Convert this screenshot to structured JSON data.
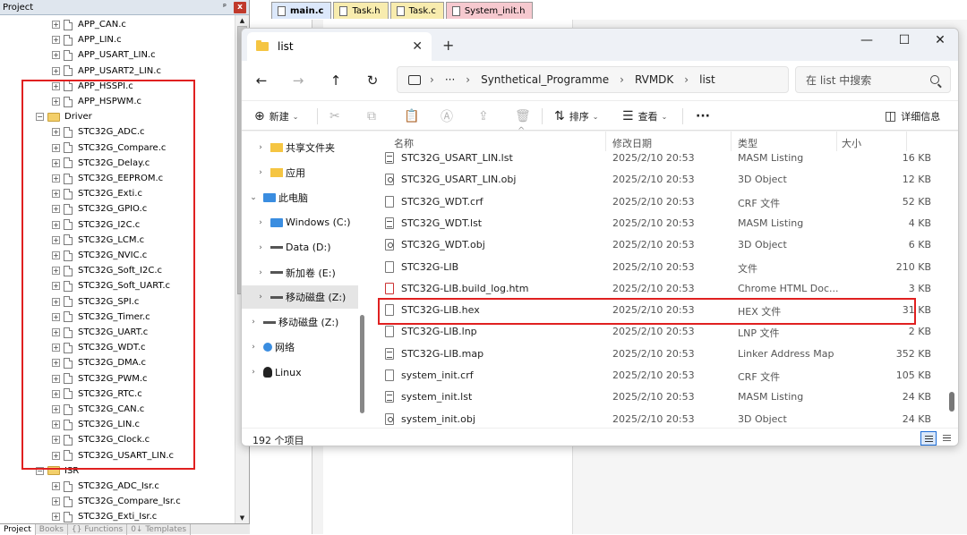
{
  "ide": {
    "project_title": "Project",
    "pin": "ᵖ",
    "close": "x",
    "tree": [
      {
        "label": "APP_CAN.c",
        "level": 2,
        "type": "file"
      },
      {
        "label": "APP_LIN.c",
        "level": 2,
        "type": "file"
      },
      {
        "label": "APP_USART_LIN.c",
        "level": 2,
        "type": "file"
      },
      {
        "label": "APP_USART2_LIN.c",
        "level": 2,
        "type": "file"
      },
      {
        "label": "APP_HSSPI.c",
        "level": 2,
        "type": "file"
      },
      {
        "label": "APP_HSPWM.c",
        "level": 2,
        "type": "file"
      },
      {
        "label": "Driver",
        "level": 1,
        "type": "folder"
      },
      {
        "label": "STC32G_ADC.c",
        "level": 2,
        "type": "file"
      },
      {
        "label": "STC32G_Compare.c",
        "level": 2,
        "type": "file"
      },
      {
        "label": "STC32G_Delay.c",
        "level": 2,
        "type": "file"
      },
      {
        "label": "STC32G_EEPROM.c",
        "level": 2,
        "type": "file"
      },
      {
        "label": "STC32G_Exti.c",
        "level": 2,
        "type": "file"
      },
      {
        "label": "STC32G_GPIO.c",
        "level": 2,
        "type": "file"
      },
      {
        "label": "STC32G_I2C.c",
        "level": 2,
        "type": "file"
      },
      {
        "label": "STC32G_LCM.c",
        "level": 2,
        "type": "file"
      },
      {
        "label": "STC32G_NVIC.c",
        "level": 2,
        "type": "file"
      },
      {
        "label": "STC32G_Soft_I2C.c",
        "level": 2,
        "type": "file"
      },
      {
        "label": "STC32G_Soft_UART.c",
        "level": 2,
        "type": "file"
      },
      {
        "label": "STC32G_SPI.c",
        "level": 2,
        "type": "file"
      },
      {
        "label": "STC32G_Timer.c",
        "level": 2,
        "type": "file"
      },
      {
        "label": "STC32G_UART.c",
        "level": 2,
        "type": "file"
      },
      {
        "label": "STC32G_WDT.c",
        "level": 2,
        "type": "file"
      },
      {
        "label": "STC32G_DMA.c",
        "level": 2,
        "type": "file"
      },
      {
        "label": "STC32G_PWM.c",
        "level": 2,
        "type": "file"
      },
      {
        "label": "STC32G_RTC.c",
        "level": 2,
        "type": "file"
      },
      {
        "label": "STC32G_CAN.c",
        "level": 2,
        "type": "file"
      },
      {
        "label": "STC32G_LIN.c",
        "level": 2,
        "type": "file"
      },
      {
        "label": "STC32G_Clock.c",
        "level": 2,
        "type": "file"
      },
      {
        "label": "STC32G_USART_LIN.c",
        "level": 2,
        "type": "file"
      },
      {
        "label": "ISR",
        "level": 1,
        "type": "folder"
      },
      {
        "label": "STC32G_ADC_Isr.c",
        "level": 2,
        "type": "file"
      },
      {
        "label": "STC32G_Compare_Isr.c",
        "level": 2,
        "type": "file"
      },
      {
        "label": "STC32G_Exti_Isr.c",
        "level": 2,
        "type": "file"
      }
    ],
    "bottom_tabs": [
      "Project",
      "Books",
      "{} Functions",
      "0↓ Templates"
    ],
    "editor_tabs": [
      {
        "label": "main.c",
        "color": "#dce8fb"
      },
      {
        "label": "Task.h",
        "color": "#f8ecae"
      },
      {
        "label": "Task.c",
        "color": "#f8ecae"
      },
      {
        "label": "System_init.h",
        "color": "#f6c9cf"
      }
    ]
  },
  "explorer": {
    "tab_title": "list",
    "new_tab": "+",
    "tab_close": "✕",
    "caption": {
      "min": "—",
      "max": "☐",
      "close": "✕"
    },
    "nav": {
      "back": "←",
      "forward": "→",
      "up": "↑",
      "refresh": "↻"
    },
    "breadcrumb": {
      "more": "···",
      "chevron": "›",
      "items": [
        "Synthetical_Programme",
        "RVMDK",
        "list"
      ]
    },
    "search_placeholder": "在 list 中搜索",
    "commands": {
      "new": "新建",
      "new_icon": "⊕",
      "cut_icon": "✂",
      "copy_icon": "⧉",
      "paste_icon": "📋",
      "rename_icon": "Ⓐ",
      "share_icon": "⇪",
      "delete_icon": "🗑",
      "sort": "排序",
      "sort_icon": "⇅",
      "view": "查看",
      "view_icon": "☰",
      "more": "···",
      "details": "详细信息",
      "details_icon": "◫",
      "dropdown": "⌄"
    },
    "nav_pane": [
      {
        "label": "共享文件夹",
        "icon": "star",
        "chevron": "›",
        "level": 1
      },
      {
        "label": "应用",
        "icon": "fold",
        "chevron": "›",
        "level": 1
      },
      {
        "label": "此电脑",
        "icon": "pc",
        "chevron": "⌄",
        "level": 0
      },
      {
        "label": "Windows (C:)",
        "icon": "pc",
        "chevron": "›",
        "level": 1
      },
      {
        "label": "Data (D:)",
        "icon": "drv",
        "chevron": "›",
        "level": 1
      },
      {
        "label": "新加卷 (E:)",
        "icon": "drv",
        "chevron": "›",
        "level": 1
      },
      {
        "label": "移动磁盘 (Z:)",
        "icon": "drv",
        "chevron": "›",
        "level": 1,
        "selected": true
      },
      {
        "label": "移动磁盘 (Z:)",
        "icon": "drv",
        "chevron": "›",
        "level": 0
      },
      {
        "label": "网络",
        "icon": "net",
        "chevron": "›",
        "level": 0
      },
      {
        "label": "Linux",
        "icon": "tux",
        "chevron": "›",
        "level": 0
      }
    ],
    "columns": {
      "name": "名称",
      "modified": "修改日期",
      "type": "类型",
      "size": "大小",
      "sort_indicator": "^"
    },
    "files": [
      {
        "name": "STC32G_USART_LIN.lst",
        "date": "2025/2/10 20:53",
        "type": "MASM Listing",
        "size": "16 KB",
        "icon": "lst"
      },
      {
        "name": "STC32G_USART_LIN.obj",
        "date": "2025/2/10 20:53",
        "type": "3D Object",
        "size": "12 KB",
        "icon": "obj"
      },
      {
        "name": "STC32G_WDT.crf",
        "date": "2025/2/10 20:53",
        "type": "CRF 文件",
        "size": "52 KB",
        "icon": "doc"
      },
      {
        "name": "STC32G_WDT.lst",
        "date": "2025/2/10 20:53",
        "type": "MASM Listing",
        "size": "4 KB",
        "icon": "lst"
      },
      {
        "name": "STC32G_WDT.obj",
        "date": "2025/2/10 20:53",
        "type": "3D Object",
        "size": "6 KB",
        "icon": "obj"
      },
      {
        "name": "STC32G-LIB",
        "date": "2025/2/10 20:53",
        "type": "文件",
        "size": "210 KB",
        "icon": "doc"
      },
      {
        "name": "STC32G-LIB.build_log.htm",
        "date": "2025/2/10 20:53",
        "type": "Chrome HTML Doc...",
        "size": "3 KB",
        "icon": "htm"
      },
      {
        "name": "STC32G-LIB.hex",
        "date": "2025/2/10 20:53",
        "type": "HEX 文件",
        "size": "31 KB",
        "icon": "doc"
      },
      {
        "name": "STC32G-LIB.lnp",
        "date": "2025/2/10 20:53",
        "type": "LNP 文件",
        "size": "2 KB",
        "icon": "doc"
      },
      {
        "name": "STC32G-LIB.map",
        "date": "2025/2/10 20:53",
        "type": "Linker Address Map",
        "size": "352 KB",
        "icon": "lst"
      },
      {
        "name": "system_init.crf",
        "date": "2025/2/10 20:53",
        "type": "CRF 文件",
        "size": "105 KB",
        "icon": "doc"
      },
      {
        "name": "system_init.lst",
        "date": "2025/2/10 20:53",
        "type": "MASM Listing",
        "size": "24 KB",
        "icon": "lst"
      },
      {
        "name": "system_init.obj",
        "date": "2025/2/10 20:53",
        "type": "3D Object",
        "size": "24 KB",
        "icon": "obj"
      }
    ],
    "status_count": "192 个项目"
  }
}
